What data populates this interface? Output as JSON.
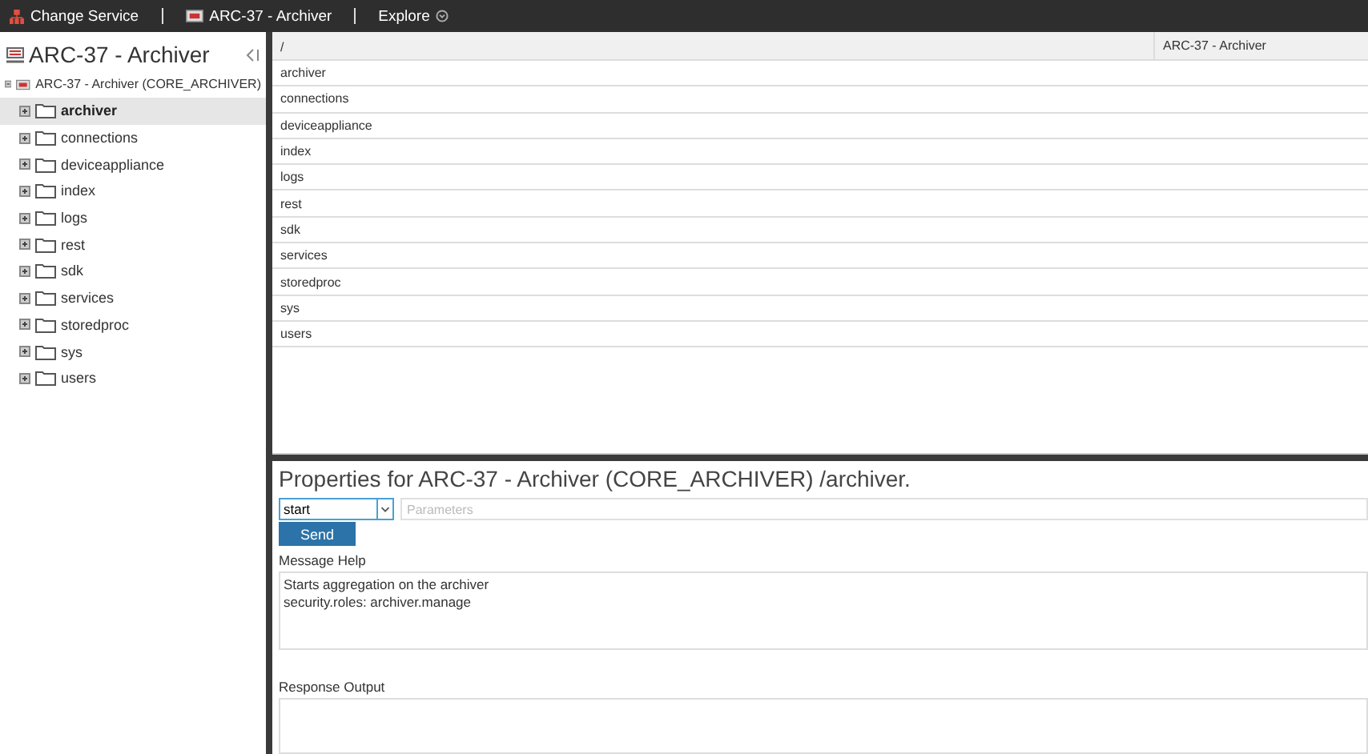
{
  "top_bar": {
    "items": [
      {
        "kind": "service",
        "label": "Change Service"
      },
      {
        "kind": "device",
        "label": "ARC-37 - Archiver"
      },
      {
        "kind": "explore",
        "label": "Explore"
      }
    ]
  },
  "sidebar": {
    "title": "ARC-37 - Archiver",
    "tree": {
      "label": "ARC-37 - Archiver (CORE_ARCHIVER)",
      "expanded": true,
      "children": [
        {
          "label": "archiver",
          "selected": true
        },
        {
          "label": "connections",
          "selected": false
        },
        {
          "label": "deviceappliance",
          "selected": false
        },
        {
          "label": "index",
          "selected": false
        },
        {
          "label": "logs",
          "selected": false
        },
        {
          "label": "rest",
          "selected": false
        },
        {
          "label": "sdk",
          "selected": false
        },
        {
          "label": "services",
          "selected": false
        },
        {
          "label": "storedproc",
          "selected": false
        },
        {
          "label": "sys",
          "selected": false
        },
        {
          "label": "users",
          "selected": false
        }
      ]
    }
  },
  "table": {
    "columns": [
      "/",
      "ARC-37 - Archiver"
    ],
    "rows": [
      [
        "archiver"
      ],
      [
        "connections"
      ],
      [
        "deviceappliance"
      ],
      [
        "index"
      ],
      [
        "logs"
      ],
      [
        "rest"
      ],
      [
        "sdk"
      ],
      [
        "services"
      ],
      [
        "storedproc"
      ],
      [
        "sys"
      ],
      [
        "users"
      ]
    ]
  },
  "properties": {
    "title": "Properties for ARC-37 - Archiver (CORE_ARCHIVER) /archiver.",
    "message": "start",
    "parameters": {
      "placeholder": "Parameters"
    },
    "send": "Send",
    "help_label": "Message Help",
    "help_lines": [
      "Starts aggregation on the archiver",
      "security.roles: archiver.manage"
    ],
    "output_label": "Response Output"
  }
}
